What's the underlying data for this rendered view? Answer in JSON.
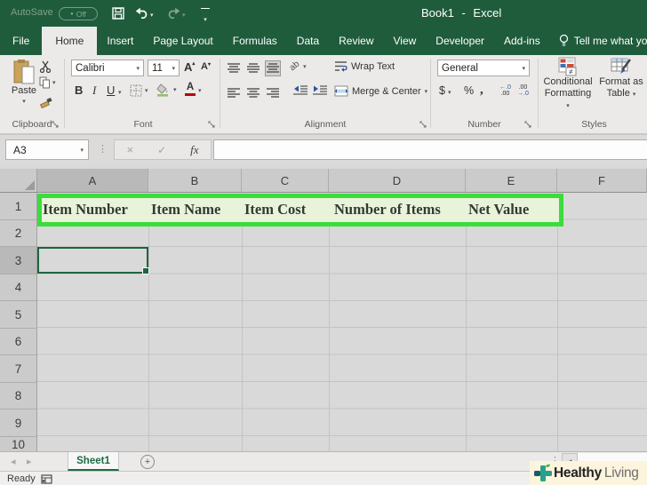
{
  "qat": {
    "autosave": "AutoSave",
    "off": "Off"
  },
  "title": "Book1 - Excel",
  "tabs": [
    "File",
    "Home",
    "Insert",
    "Page Layout",
    "Formulas",
    "Data",
    "Review",
    "View",
    "Developer",
    "Add-ins"
  ],
  "tellme": "Tell me what you want",
  "ribbon": {
    "clipboard": {
      "paste": "Paste",
      "label": "Clipboard"
    },
    "font": {
      "name": "Calibri",
      "size": "11",
      "bold": "B",
      "italic": "I",
      "underline": "U",
      "grow": "A",
      "shrink": "A",
      "color_letter": "A",
      "label": "Font"
    },
    "alignment": {
      "orientation": "ab",
      "wrap": "Wrap Text",
      "merge": "Merge & Center",
      "label": "Alignment"
    },
    "number": {
      "format": "General",
      "currency": "$",
      "percent": "%",
      "comma": ",",
      "inc_top": "←.0",
      "inc_bot": ".00",
      "dec_top": ".00",
      "dec_bot": "→.0",
      "label": "Number"
    },
    "styles": {
      "cf1": "Conditional",
      "cf2": "Formatting",
      "ft1": "Format as",
      "ft2": "Table",
      "label": "Styles"
    }
  },
  "formula": {
    "name_box": "A3",
    "cancel": "×",
    "enter": "✓",
    "fx": "fx"
  },
  "grid": {
    "columns": [
      "A",
      "B",
      "C",
      "D",
      "E",
      "F"
    ],
    "rows": [
      "1",
      "2",
      "3",
      "4",
      "5",
      "6",
      "7",
      "8",
      "9",
      "10"
    ],
    "row1": [
      "Item Number",
      "Item Name",
      "Item Cost",
      "Number of Items",
      "Net Value"
    ],
    "selected_cell": "A3"
  },
  "sheetbar": {
    "sheet": "Sheet1",
    "plus": "+"
  },
  "status": {
    "ready": "Ready"
  },
  "watermark": {
    "bold": "Healthy",
    "light": "Living"
  },
  "icons": {
    "caret": "▾",
    "up": "▴",
    "prev": "◂",
    "next": "▸",
    "scroll_left": "◄",
    "grip": "⋮",
    "dot": "●"
  },
  "colors": {
    "excel_green": "#1f5c3c",
    "annotation_green": "#3bdc3b",
    "sheet_tab_green": "#1d6b43",
    "watermark_teal": "#2aa08c",
    "leaf_green": "#5cb53e",
    "selection_green": "#1e6440"
  }
}
